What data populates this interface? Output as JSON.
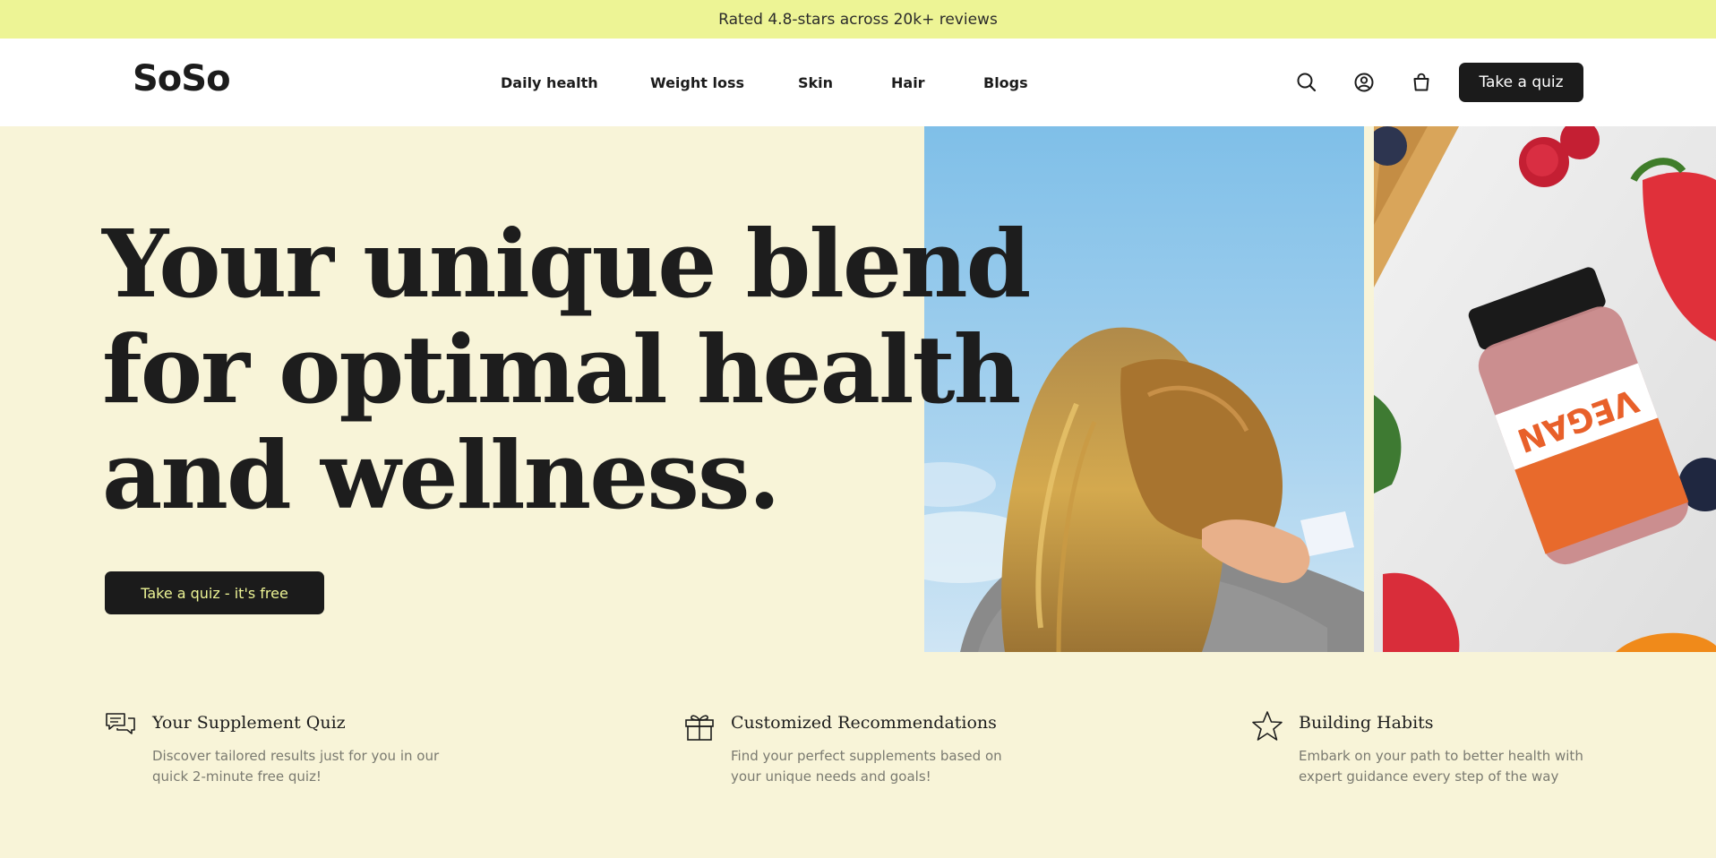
{
  "announcement": {
    "text": "Rated 4.8-stars across 20k+ reviews"
  },
  "header": {
    "logo": "SoSo",
    "nav": [
      "Daily health",
      "Weight loss",
      "Skin",
      "Hair",
      "Blogs"
    ],
    "icons": [
      "search-icon",
      "account-icon",
      "bag-icon"
    ],
    "cta": "Take a quiz"
  },
  "hero": {
    "title_lines": [
      "Your unique blend",
      "for optimal health",
      "and wellness."
    ],
    "cta": "Take a quiz - it's free",
    "product_label": "VEGAN"
  },
  "features": [
    {
      "icon": "chat-icon",
      "title": "Your Supplement Quiz",
      "description": "Discover tailored results just for you in our quick 2-minute free quiz!"
    },
    {
      "icon": "gift-icon",
      "title": "Customized Recommendations",
      "description": "Find your perfect supplements based on your unique needs and goals!"
    },
    {
      "icon": "star-icon",
      "title": "Building Habits",
      "description": "Embark on your path to better health with expert guidance every step of the way"
    }
  ],
  "colors": {
    "announcement_bg": "#EDF495",
    "page_bg": "#F8F4D8",
    "button_bg": "#1b1b1b",
    "hero_cta_text": "#EDF495"
  }
}
